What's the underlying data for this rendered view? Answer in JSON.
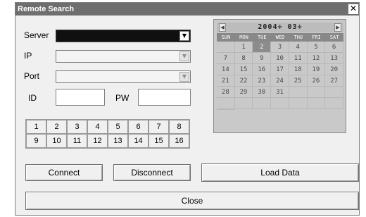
{
  "window": {
    "title": "Remote Search",
    "close_glyph": "✕"
  },
  "form": {
    "server_label": "Server",
    "ip_label": "IP",
    "port_label": "Port",
    "id_label": "ID",
    "pw_label": "PW",
    "server_value": "",
    "id_value": "",
    "pw_value": ""
  },
  "channels": [
    "1",
    "2",
    "3",
    "4",
    "5",
    "6",
    "7",
    "8",
    "9",
    "10",
    "11",
    "12",
    "13",
    "14",
    "15",
    "16"
  ],
  "buttons": {
    "connect": "Connect",
    "disconnect": "Disconnect",
    "load_data": "Load Data",
    "close": "Close"
  },
  "calendar": {
    "year": "2004",
    "month": "03",
    "prev_icon": "chevron-left-icon",
    "next_icon": "chevron-right-icon",
    "weekdays": [
      "SUN",
      "MON",
      "TUE",
      "WED",
      "THU",
      "FRI",
      "SAT"
    ],
    "days": [
      "",
      "1",
      "2",
      "3",
      "4",
      "5",
      "6",
      "7",
      "8",
      "9",
      "10",
      "11",
      "12",
      "13",
      "14",
      "15",
      "16",
      "17",
      "18",
      "19",
      "20",
      "21",
      "22",
      "23",
      "24",
      "25",
      "26",
      "27",
      "28",
      "29",
      "30",
      "31",
      "",
      "",
      "",
      "",
      "",
      "",
      "",
      "",
      "",
      "",
      ""
    ],
    "selected_day": "2"
  }
}
